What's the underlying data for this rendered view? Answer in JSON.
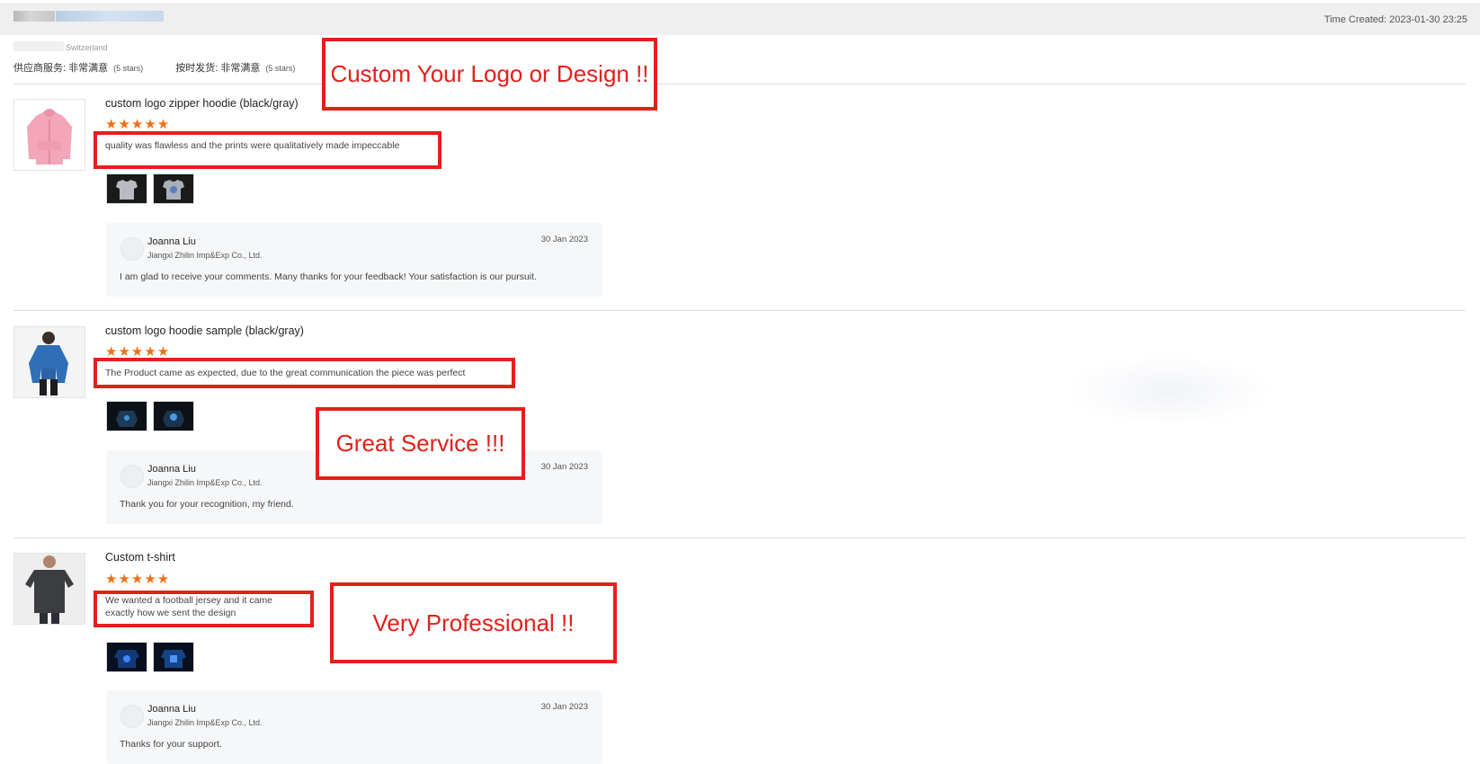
{
  "header": {
    "time_created": "Time Created: 2023-01-30 23:25",
    "country": "Switzerland",
    "ratings": [
      {
        "label": "供应商服务: 非常满意",
        "stars": "(5 stars)"
      },
      {
        "label": "按时发货: 非常满意",
        "stars": "(5 stars)"
      }
    ]
  },
  "reviews": [
    {
      "product_title": "custom logo zipper hoodie (black/gray)",
      "stars": "★★★★★",
      "review_text": "quality was flawless and the prints were qualitatively made impeccable",
      "reply": {
        "name": "Joanna Liu",
        "company": "Jiangxi Zhilin Imp&Exp Co., Ltd.",
        "date": "30 Jan 2023",
        "text": "I am glad to receive your comments. Many thanks for your feedback! Your satisfaction is our pursuit."
      }
    },
    {
      "product_title": "custom logo hoodie sample (black/gray)",
      "stars": "★★★★★",
      "review_text": "The Product came as expected, due to the great communication the piece was perfect",
      "reply": {
        "name": "Joanna Liu",
        "company": "Jiangxi Zhilin Imp&Exp Co., Ltd.",
        "date": "30 Jan 2023",
        "text": "Thank you for your recognition, my friend."
      }
    },
    {
      "product_title": "Custom t-shirt",
      "stars": "★★★★★",
      "review_text": "We wanted a football jersey and it came exactly how we sent the design",
      "reply": {
        "name": "Joanna Liu",
        "company": "Jiangxi Zhilin Imp&Exp Co., Ltd.",
        "date": "30 Jan 2023",
        "text": "Thanks for your support."
      }
    }
  ],
  "annotations": {
    "callout_1": "Custom Your Logo or Design !!",
    "callout_2": "Great Service !!!",
    "callout_3": "Very Professional !!",
    "color": "#e3201b"
  },
  "theme": {
    "star_color": "#f07014",
    "topbar_bg": "#efefef",
    "reply_bg": "#f6f7f9"
  }
}
